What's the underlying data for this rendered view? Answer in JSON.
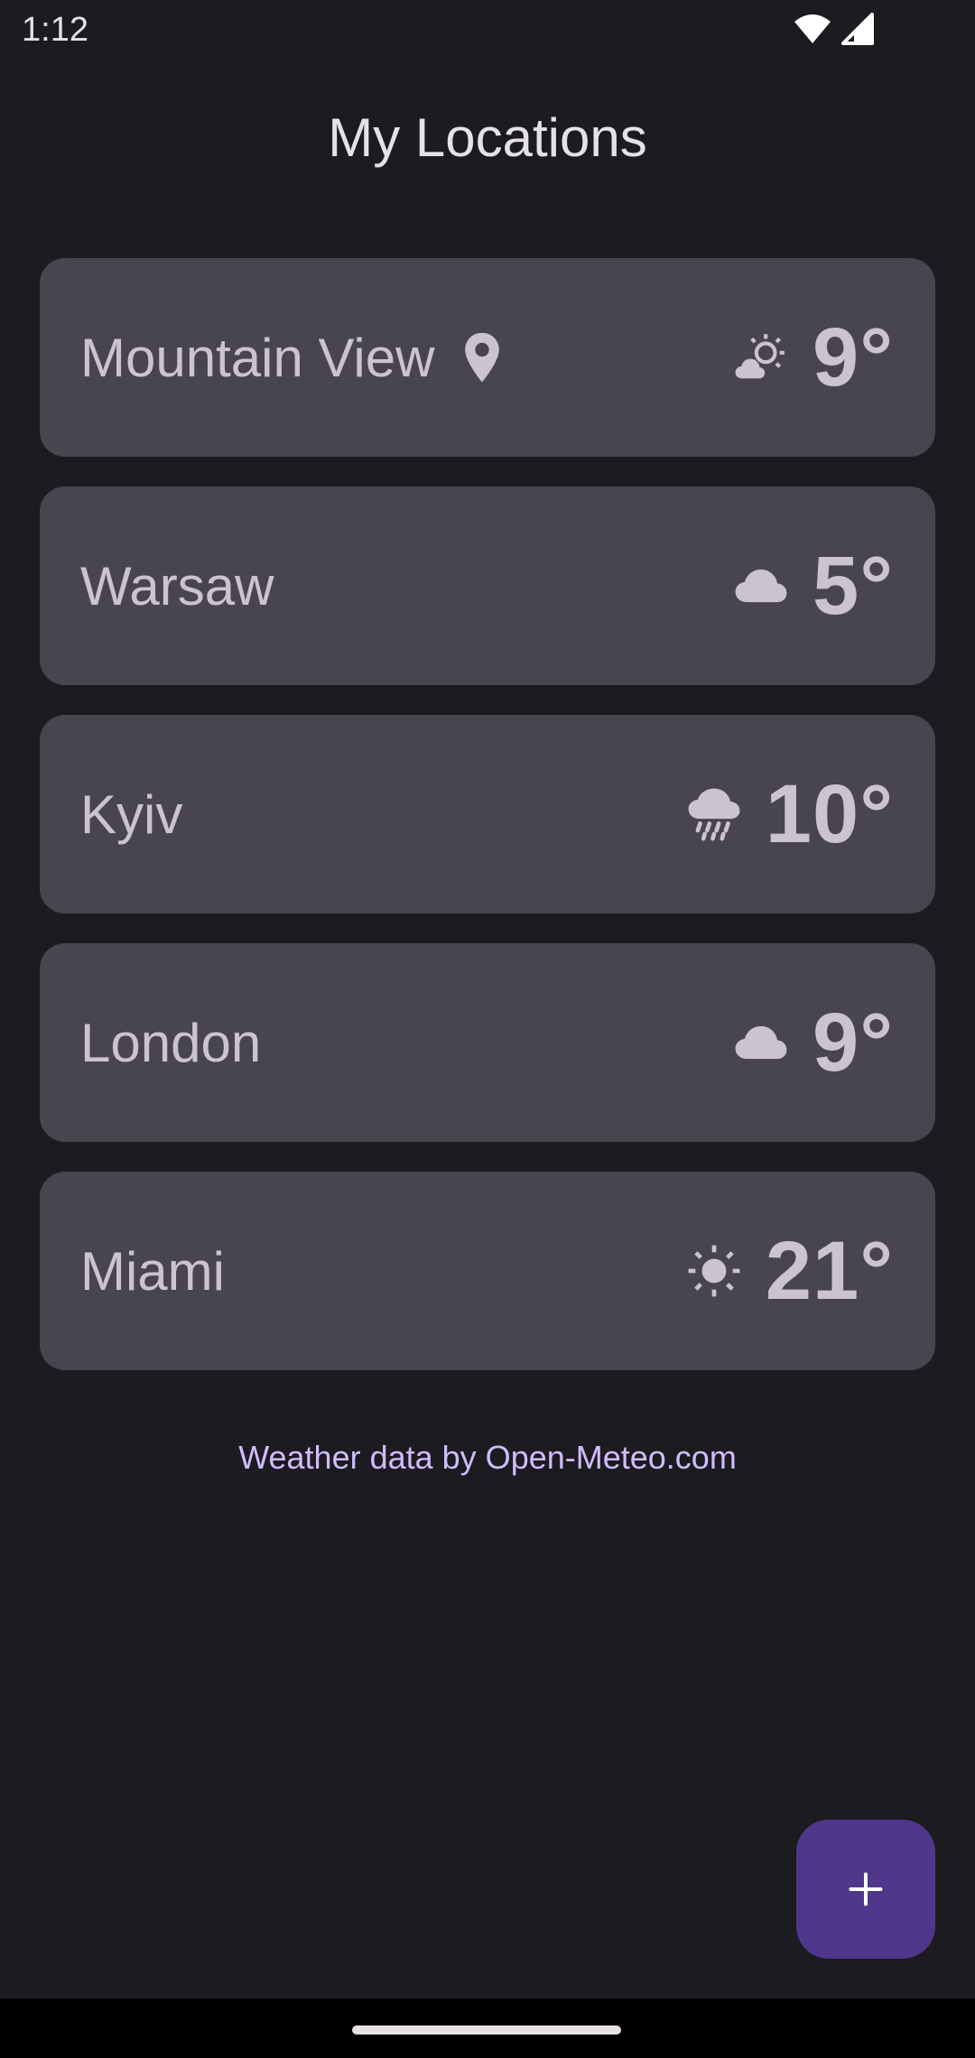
{
  "status_bar": {
    "time": "1:12",
    "icons": [
      "wifi-icon",
      "cellular-signal-icon"
    ]
  },
  "page": {
    "title": "My Locations"
  },
  "locations": [
    {
      "name": "Mountain View",
      "current_location": true,
      "weather_icon": "partly-cloudy-icon",
      "temp": "9°"
    },
    {
      "name": "Warsaw",
      "current_location": false,
      "weather_icon": "cloud-icon",
      "temp": "5°"
    },
    {
      "name": "Kyiv",
      "current_location": false,
      "weather_icon": "rain-cloud-icon",
      "temp": "10°"
    },
    {
      "name": "London",
      "current_location": false,
      "weather_icon": "cloud-icon",
      "temp": "9°"
    },
    {
      "name": "Miami",
      "current_location": false,
      "weather_icon": "sun-icon",
      "temp": "21°"
    }
  ],
  "attribution": {
    "text": "Weather data by Open-Meteo.com"
  },
  "fab": {
    "icon": "plus-icon"
  },
  "colors": {
    "background": "#1c1b20",
    "card": "#49454f",
    "card_text": "#cac4d0",
    "accent": "#d0bcff",
    "fab": "#4f378b"
  }
}
